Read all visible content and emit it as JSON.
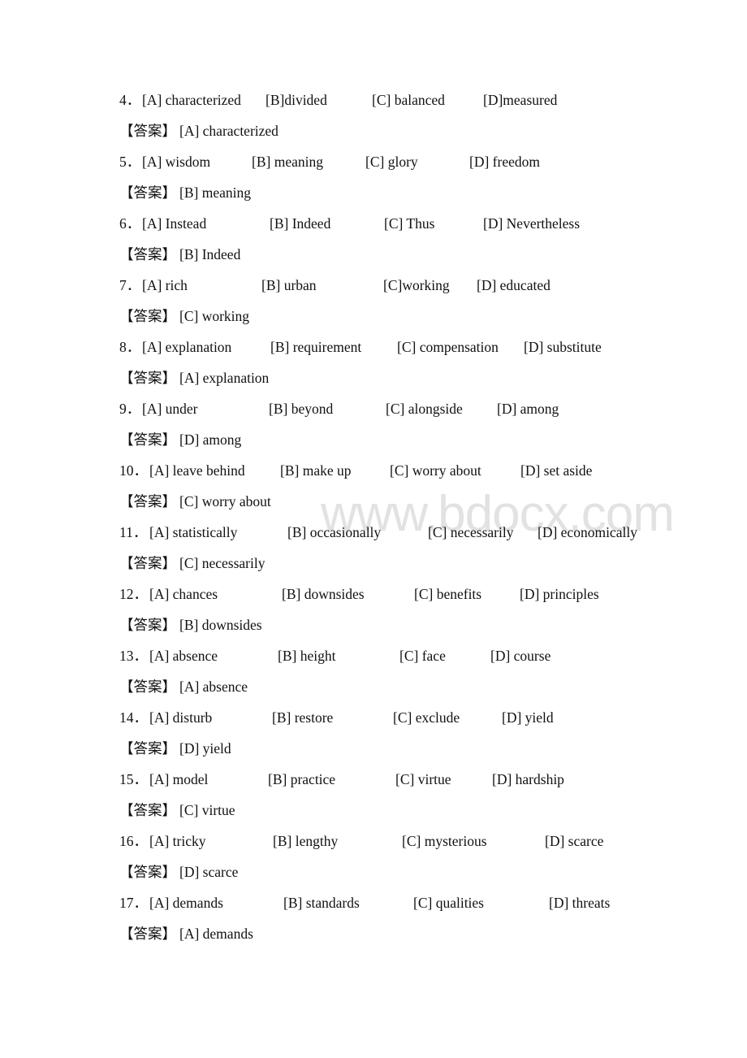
{
  "watermark": "www.bdocx.com",
  "answer_prefix": "【答案】",
  "questions": [
    {
      "number": "4．",
      "options": [
        "[A] characterized",
        "[B]divided",
        "[C] balanced",
        "[D]measured"
      ],
      "answer": "[A] characterized"
    },
    {
      "number": "5．",
      "options": [
        "[A] wisdom",
        "[B] meaning",
        "[C] glory",
        "[D] freedom"
      ],
      "answer": "[B] meaning"
    },
    {
      "number": "6．",
      "options": [
        "[A] Instead",
        "[B] Indeed",
        "[C] Thus",
        "[D] Nevertheless"
      ],
      "answer": "[B] Indeed"
    },
    {
      "number": "7．",
      "options": [
        "[A] rich",
        "[B] urban",
        "[C]working",
        "[D] educated"
      ],
      "answer": "[C] working"
    },
    {
      "number": "8．",
      "options": [
        "[A] explanation",
        "[B] requirement",
        "[C] compensation",
        "[D] substitute"
      ],
      "answer": "[A] explanation"
    },
    {
      "number": "9．",
      "options": [
        "[A] under",
        "[B] beyond",
        "[C] alongside",
        "[D] among"
      ],
      "answer": "[D] among"
    },
    {
      "number": "10．",
      "options": [
        "[A] leave behind",
        "[B] make up",
        "[C] worry about",
        "[D] set aside"
      ],
      "answer": "[C] worry about"
    },
    {
      "number": "11．",
      "options": [
        "[A] statistically",
        "[B] occasionally",
        "[C] necessarily",
        "[D] economically"
      ],
      "answer": "[C] necessarily"
    },
    {
      "number": "12．",
      "options": [
        "[A] chances",
        "[B] downsides",
        "[C] benefits",
        "[D] principles"
      ],
      "answer": "[B] downsides"
    },
    {
      "number": "13．",
      "options": [
        "[A] absence",
        "[B] height",
        "[C] face",
        "[D] course"
      ],
      "answer": "[A] absence"
    },
    {
      "number": "14．",
      "options": [
        "[A] disturb",
        "[B] restore",
        "[C] exclude",
        "[D] yield"
      ],
      "answer": "[D] yield"
    },
    {
      "number": "15．",
      "options": [
        "[A] model",
        "[B] practice",
        "[C] virtue",
        "[D] hardship"
      ],
      "answer": "[C] virtue"
    },
    {
      "number": "16．",
      "options": [
        "[A] tricky",
        "[B] lengthy",
        "[C] mysterious",
        "[D] scarce"
      ],
      "answer": "[D] scarce"
    },
    {
      "number": "17．",
      "options": [
        "[A] demands",
        "[B] standards",
        "[C] qualities",
        "[D] threats"
      ],
      "answer": "[A] demands"
    }
  ]
}
